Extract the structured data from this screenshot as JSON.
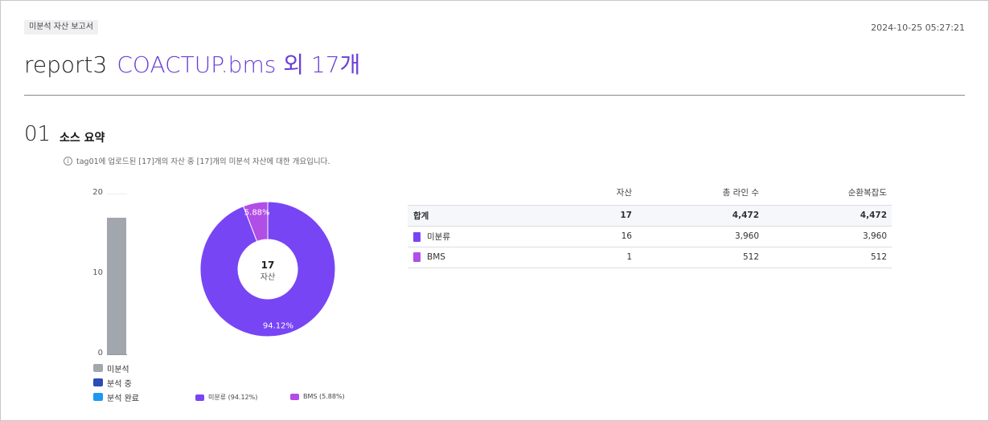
{
  "header": {
    "badge": "미분석 자산 보고서",
    "timestamp": "2024-10-25 05:27:21",
    "title_name": "report3",
    "title_sub": "COACTUP.bms 외 17개"
  },
  "section": {
    "number": "01",
    "title": "소스 요약",
    "info_icon": "info-icon",
    "info_text": "tag01에 업로드된 [17]개의 자산 중 [17]개의 미분석 자산에 대한 개요입니다."
  },
  "colors": {
    "accent": "#6a3fd6",
    "unanalyzed": "#a2a6ad",
    "analyzing": "#2b4bb5",
    "analyzed": "#1f97f0",
    "unclassified": "#7845f5",
    "bms": "#b14ee6"
  },
  "chart_data": [
    {
      "type": "bar",
      "categories": [
        ""
      ],
      "series": [
        {
          "name": "미분석",
          "values": [
            17
          ]
        },
        {
          "name": "분석 중",
          "values": [
            0
          ]
        },
        {
          "name": "분석 완료",
          "values": [
            0
          ]
        }
      ],
      "ylim": [
        0,
        20
      ],
      "yticks": [
        "20",
        "10",
        "0"
      ],
      "legend": "bottom"
    },
    {
      "type": "pie",
      "labels": [
        "미분류",
        "BMS"
      ],
      "values": [
        94.12,
        5.88
      ],
      "data_labels": [
        "94.12%",
        "5.88%"
      ],
      "center_value": "17",
      "center_label": "자산",
      "legend_labels": [
        "미분류 (94.12%)",
        "BMS (5.88%)"
      ],
      "legend": "bottom"
    }
  ],
  "table": {
    "headers": [
      "",
      "자산",
      "총 라인 수",
      "순환복잡도"
    ],
    "total": {
      "name": "합계",
      "assets": "17",
      "lines": "4,472",
      "complexity": "4,472"
    },
    "rows": [
      {
        "name": "미분류",
        "assets": "16",
        "lines": "3,960",
        "complexity": "3,960"
      },
      {
        "name": "BMS",
        "assets": "1",
        "lines": "512",
        "complexity": "512"
      }
    ]
  }
}
